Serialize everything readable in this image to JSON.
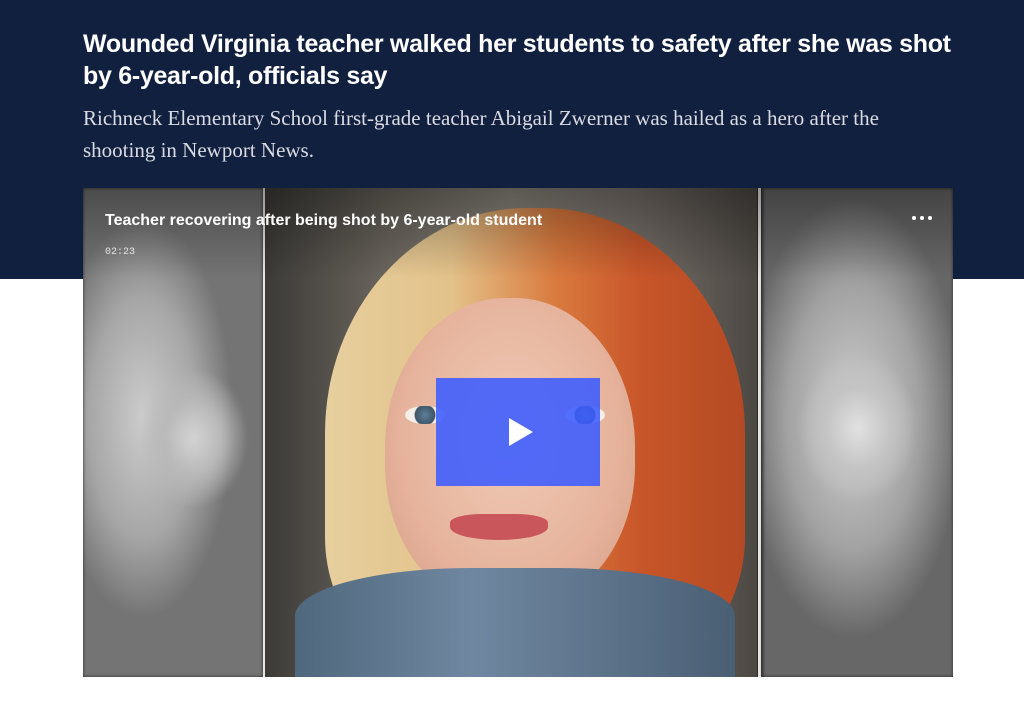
{
  "article": {
    "headline": "Wounded Virginia teacher walked her students to safety after she was shot by 6-year-old, officials say",
    "dek": "Richneck Elementary School first-grade teacher Abigail Zwerner was hailed as a hero after the shooting in Newport News."
  },
  "video": {
    "title": "Teacher recovering after being shot by 6-year-old student",
    "duration": "02:23",
    "more_icon": "more-horizontal-icon",
    "play_icon": "play-icon",
    "play_button_color": "#3b5cff"
  },
  "colors": {
    "header_background": "#12203f",
    "page_background": "#ffffff"
  }
}
